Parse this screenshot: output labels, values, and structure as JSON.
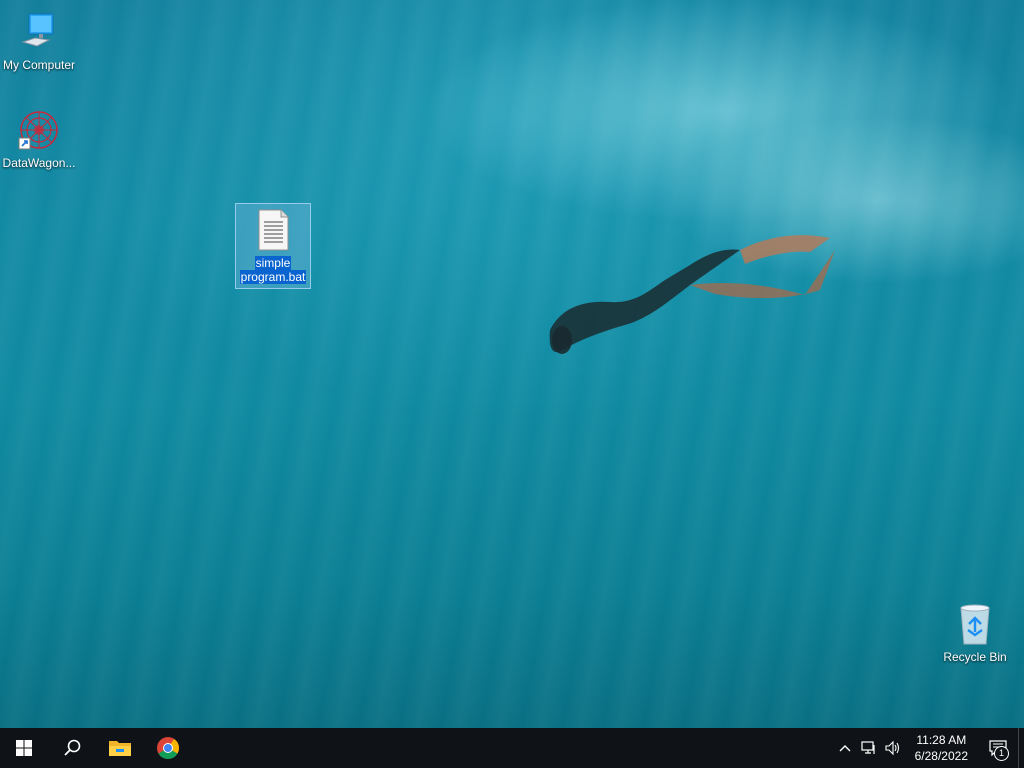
{
  "desktop": {
    "icons": [
      {
        "label": "My Computer",
        "icon": "computer-icon"
      },
      {
        "label": "DataWagon...",
        "icon": "datawagon-icon"
      },
      {
        "label_line1": "simple",
        "label_line2": "program.bat",
        "icon": "batch-file-icon",
        "selected": true
      },
      {
        "label": "Recycle Bin",
        "icon": "recycle-bin-icon"
      }
    ]
  },
  "taskbar": {
    "apps": [
      "start-icon",
      "search-icon",
      "file-explorer-icon",
      "chrome-icon"
    ],
    "tray": {
      "time": "11:28 AM",
      "date": "6/28/2022",
      "notification_count": "1"
    }
  },
  "colors": {
    "selection": "#0a64d0",
    "taskbar": "#0f1216",
    "windows_blue": "#1c8ff5"
  }
}
